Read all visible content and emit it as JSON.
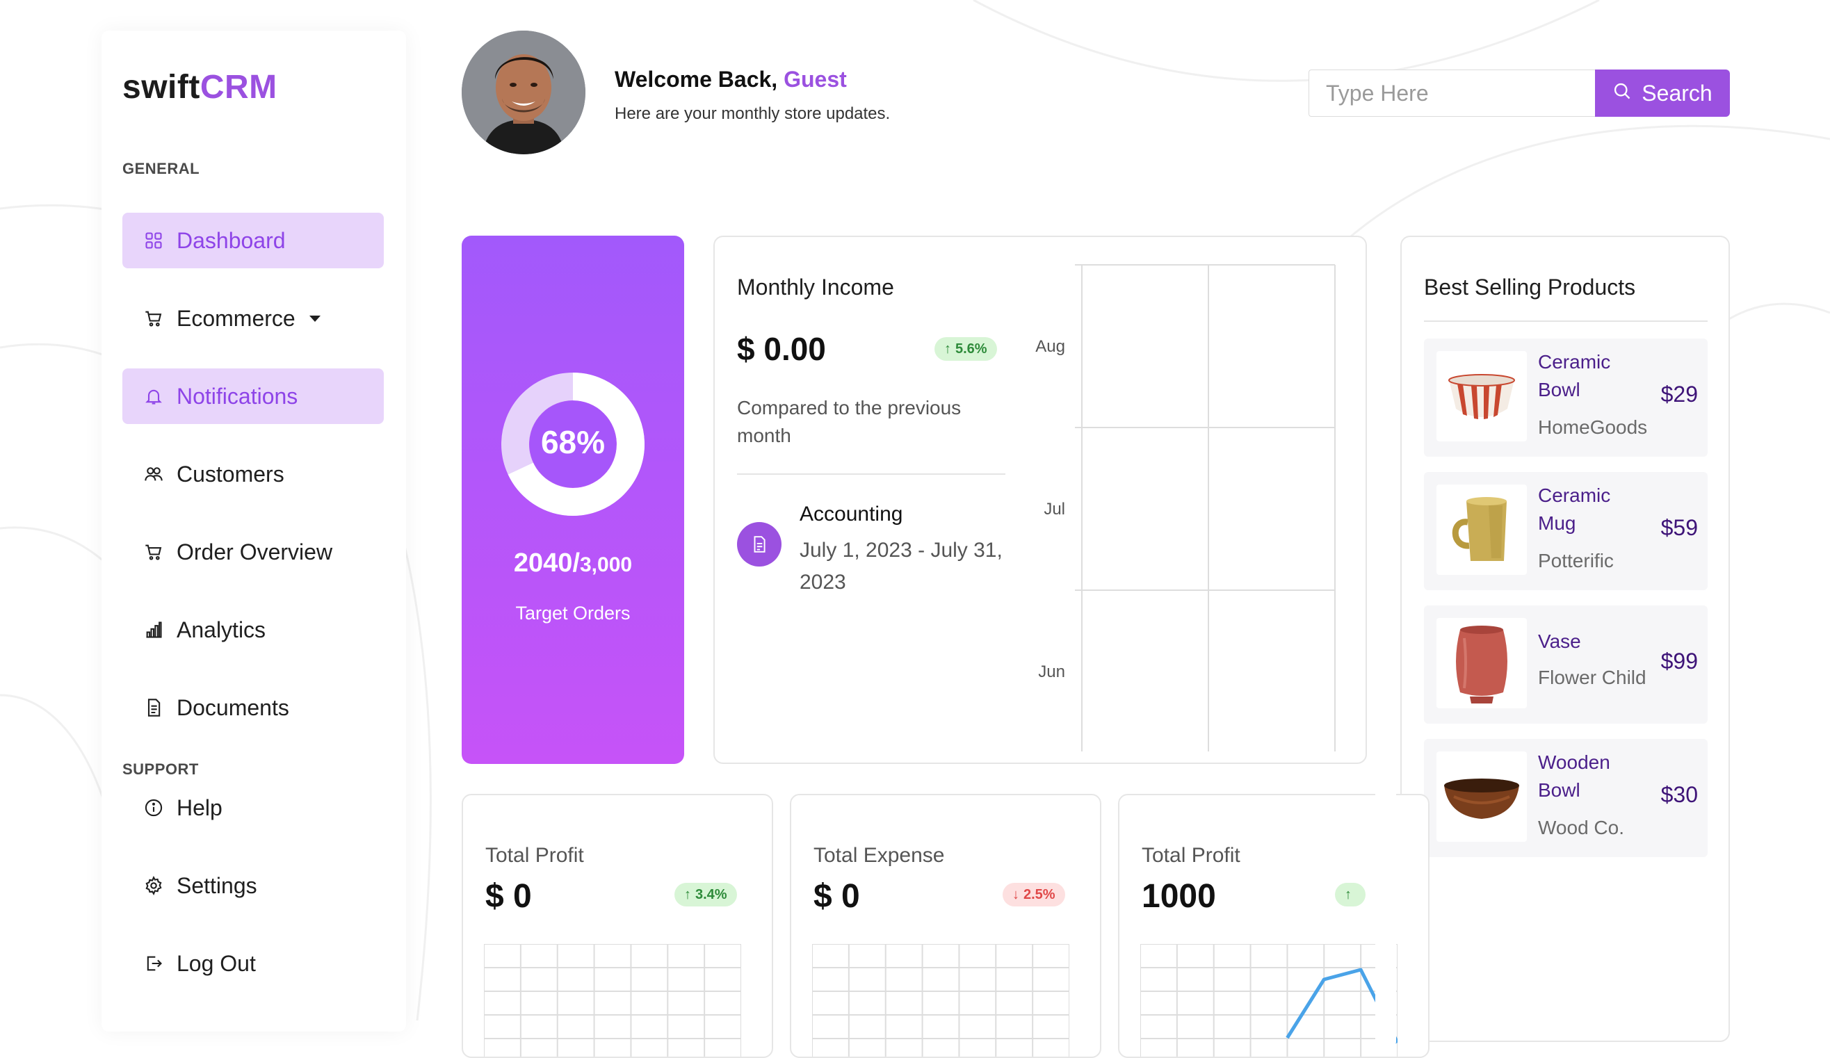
{
  "brand": {
    "name_dark": "swift",
    "name_accent": "CRM"
  },
  "sidebar": {
    "general_label": "GENERAL",
    "support_label": "SUPPORT",
    "items": [
      {
        "label": "Dashboard",
        "icon": "grid-icon",
        "active": true
      },
      {
        "label": "Ecommerce",
        "icon": "cart-icon",
        "has_dropdown": true
      },
      {
        "label": "Notifications",
        "icon": "bell-icon",
        "active": true
      },
      {
        "label": "Customers",
        "icon": "users-icon"
      },
      {
        "label": "Order Overview",
        "icon": "cart-icon"
      },
      {
        "label": "Analytics",
        "icon": "bar-chart-icon"
      },
      {
        "label": "Documents",
        "icon": "document-icon"
      }
    ],
    "support_items": [
      {
        "label": "Help",
        "icon": "info-icon"
      },
      {
        "label": "Settings",
        "icon": "gear-icon"
      },
      {
        "label": "Log Out",
        "icon": "logout-icon"
      }
    ]
  },
  "header": {
    "welcome_prefix": "Welcome Back,",
    "welcome_name": "Guest",
    "subtitle": "Here are your monthly store updates.",
    "search_placeholder": "Type Here",
    "search_button": "Search"
  },
  "target": {
    "percent_label": "68%",
    "percent": 0.68,
    "current": "2040/",
    "total": "3,000",
    "label": "Target Orders"
  },
  "income": {
    "title": "Monthly Income",
    "value": "$ 0.00",
    "change": "5.6%",
    "compare_text": "Compared to the previous month",
    "accounting_title": "Accounting",
    "accounting_dates": "July 1, 2023 - July 31, 2023"
  },
  "best_selling": {
    "title": "Best Selling Products",
    "products": [
      {
        "name": "Ceramic Bowl",
        "brand": "HomeGoods",
        "price": "$29"
      },
      {
        "name": "Ceramic Mug",
        "brand": "Potterific",
        "price": "$59"
      },
      {
        "name": "Vase",
        "brand": "Flower Child",
        "price": "$99"
      },
      {
        "name": "Wooden Bowl",
        "brand": "Wood Co.",
        "price": "$30"
      }
    ]
  },
  "mini_cards": [
    {
      "title": "Total Profit",
      "value": "$ 0",
      "change": "3.4%",
      "direction": "up"
    },
    {
      "title": "Total Expense",
      "value": "$ 0",
      "change": "2.5%",
      "direction": "down"
    },
    {
      "title": "Total Profit",
      "value": "1000",
      "change": "",
      "direction": "up"
    }
  ],
  "colors": {
    "accent": "#9b51e0",
    "active_bg": "#e8d5fb",
    "up": "#2e8b3a",
    "down": "#e04848",
    "line": "#4aa3e8"
  },
  "chart_data": [
    {
      "type": "bar",
      "orientation": "horizontal",
      "categories": [
        "Aug",
        "Jul",
        "Jun"
      ],
      "values": [
        0,
        0,
        0
      ],
      "xlim": [
        0,
        1
      ],
      "x_ticks": [
        "0",
        "0.5",
        "1"
      ],
      "grid": true
    },
    {
      "type": "line",
      "x": [
        0,
        1,
        2,
        3,
        4,
        5,
        6,
        7
      ],
      "values": [
        null,
        null,
        null,
        null,
        0.25,
        0.85,
        0.95,
        0.2
      ],
      "grid": true
    }
  ]
}
